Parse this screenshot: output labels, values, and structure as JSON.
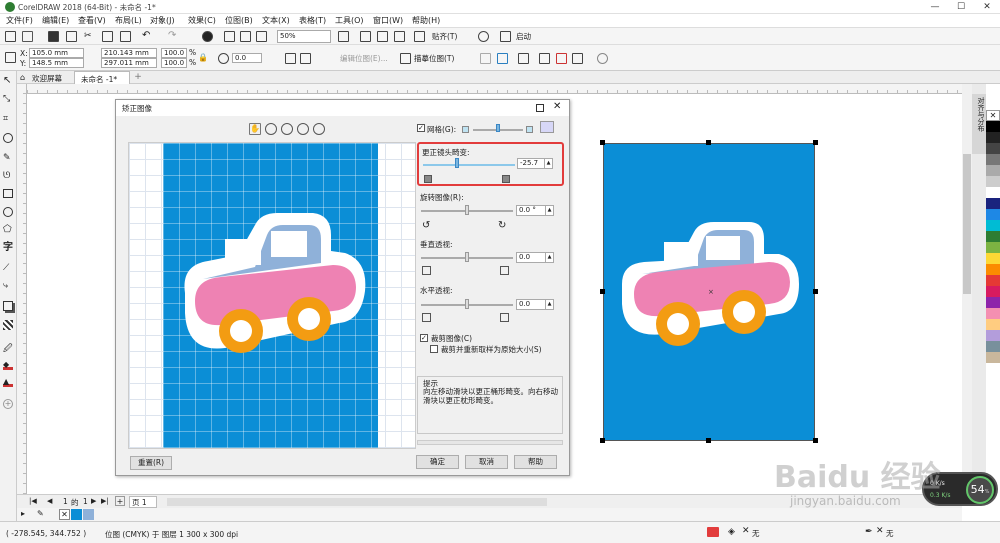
{
  "app": {
    "title": "CorelDRAW 2018 (64-Bit) - 未命名 -1*"
  },
  "menu": [
    "文件(F)",
    "编辑(E)",
    "查看(V)",
    "布局(L)",
    "对象(J)",
    "效果(C)",
    "位图(B)",
    "文本(X)",
    "表格(T)",
    "工具(O)",
    "窗口(W)",
    "帮助(H)"
  ],
  "toolbar": {
    "zoom": "50%",
    "snap_label": "贴齐(T)",
    "launch_label": "启动"
  },
  "propbar": {
    "x": "105.0 mm",
    "y": "148.5 mm",
    "w": "210.143 mm",
    "h": "297.011 mm",
    "sx": "100.0",
    "sy": "100.0",
    "pct": "%",
    "rotate": "0.0",
    "edit_bitmap": "编辑位图(E)...",
    "trace_bitmap": "描摹位图(T)"
  },
  "tabs": {
    "welcome": "欢迎屏幕",
    "doc": "未命名 -1*"
  },
  "dialog": {
    "title": "矫正图像",
    "grid_label": "网格(G):",
    "lens": {
      "label": "更正镜头畸变:",
      "value": "-25.7"
    },
    "rotate": {
      "label": "旋转图像(R):",
      "value": "0.0 °"
    },
    "vertical": {
      "label": "垂直透视:",
      "value": "0.0"
    },
    "horizontal": {
      "label": "水平透视:",
      "value": "0.0"
    },
    "crop_label": "裁剪图像(C)",
    "crop_resample_label": "裁剪并重新取样为原始大小(S)",
    "hint_title": "提示",
    "hint_text": "向左移动滑块以更正桶形畸变。向右移动滑块以更正枕形畸变。",
    "reset": "重置(R)",
    "ok": "确定",
    "cancel": "取消",
    "help": "帮助"
  },
  "page_nav": {
    "current": "1",
    "sep": "的",
    "total": "1",
    "page_tab": "页 1"
  },
  "status": {
    "coords": "( -278.545, 344.752 )",
    "info": "位图 (CMYK) 于 图层 1 300 x 300 dpi",
    "fill": "无",
    "outline": "无"
  },
  "dock_label": "对齐与分布",
  "overlay": {
    "speed_big": "54",
    "unit": "%",
    "down": "0 K/s",
    "up": "0.3 K/s"
  },
  "watermark": {
    "brand": "Baidu 经验",
    "url": "jingyan.baidu.com"
  },
  "colors": {
    "accent": "#e23c3c",
    "blue_bg": "#0b8ed6",
    "car_pink": "#ee82b3",
    "car_blue": "#8fb1d9",
    "wheel": "#f39c12"
  }
}
